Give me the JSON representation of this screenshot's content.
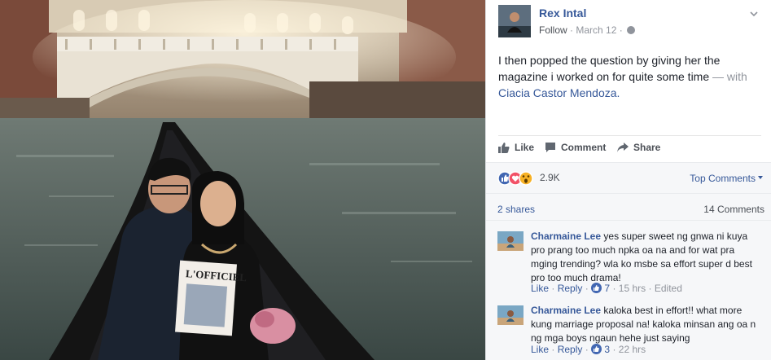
{
  "post": {
    "author": "Rex Intal",
    "follow_label": "Follow",
    "date": "March 12",
    "text_main": "I then popped the question by giving her the magazine i worked on for quite some time",
    "text_with": "— with",
    "tagged_name": "Ciacia Castor Mendoza."
  },
  "actions": {
    "like": "Like",
    "comment": "Comment",
    "share": "Share"
  },
  "reactions": {
    "count": "2.9K",
    "sort_label": "Top Comments",
    "types": [
      "like-icon",
      "love-icon",
      "wow-icon"
    ],
    "colors": {
      "like": "#4267b2",
      "love": "#f25268",
      "wow": "#f7b125"
    }
  },
  "engagement": {
    "shares": "2 shares",
    "comments": "14 Comments"
  },
  "comments": [
    {
      "name": "Charmaine Lee",
      "text": "yes super sweet ng gnwa ni kuya pro prang too much npka oa na and for wat pra mging trending? wla ko msbe sa effort super d best pro too much drama!",
      "like": "Like",
      "reply": "Reply",
      "likes": "7",
      "time": "15 hrs",
      "edited": "Edited"
    },
    {
      "name": "Charmaine Lee",
      "text": "kaloka best in effort!! what more kung marriage proposal na! kaloka minsan ang oa n ng mga boys ngaun hehe just saying",
      "like": "Like",
      "reply": "Reply",
      "likes": "3",
      "time": "22 hrs"
    }
  ],
  "photo": {
    "magazine_title": "L'OFFICIEL"
  },
  "theme": {
    "link": "#365899",
    "muted": "#90949c",
    "panel_bg": "#f6f7f9"
  }
}
